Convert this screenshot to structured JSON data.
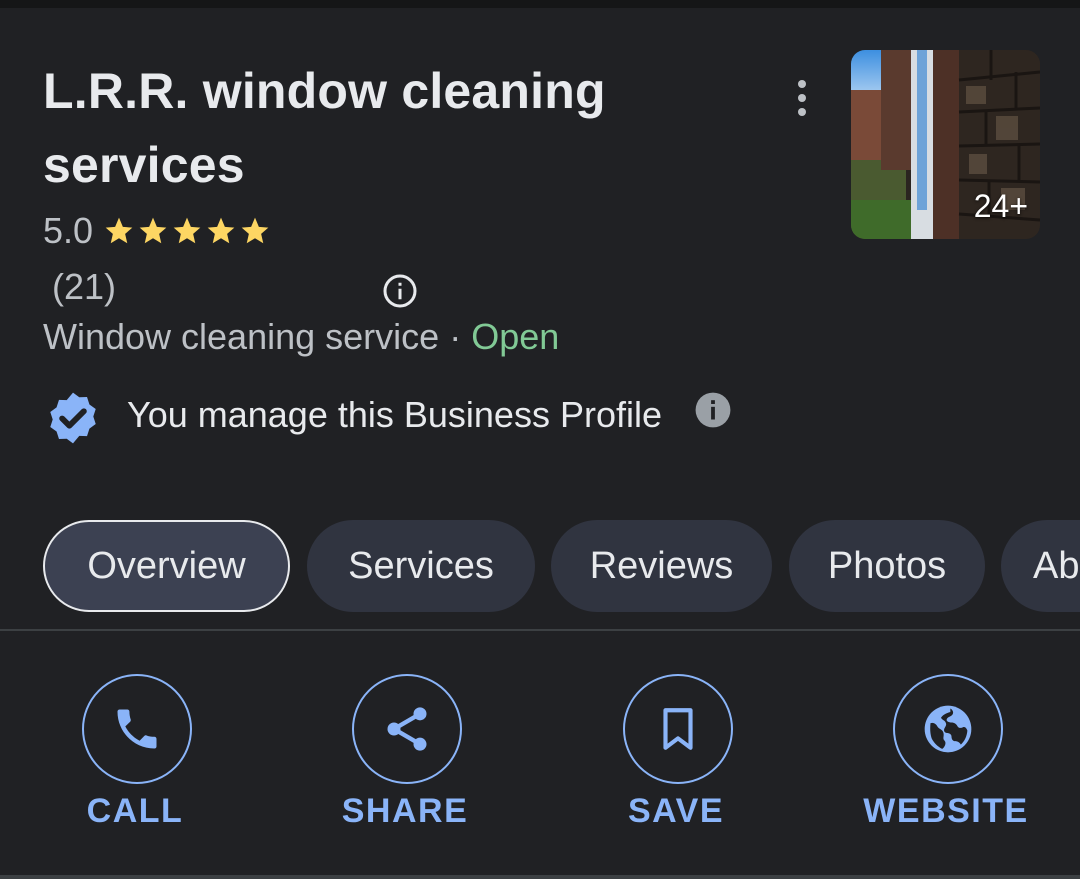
{
  "business": {
    "name": "L.R.R. window cleaning services",
    "rating": "5.0",
    "stars": 5,
    "review_count": "(21)",
    "category": "Window cleaning service",
    "separator": " · ",
    "status": "Open",
    "photo_count": "24+"
  },
  "owner_notice": {
    "text": "You manage this Business Profile"
  },
  "tabs": [
    {
      "label": "Overview",
      "active": true
    },
    {
      "label": "Services",
      "active": false
    },
    {
      "label": "Reviews",
      "active": false
    },
    {
      "label": "Photos",
      "active": false
    },
    {
      "label": "Ab",
      "active": false
    }
  ],
  "actions": {
    "call": "CALL",
    "share": "SHARE",
    "save": "SAVE",
    "website": "WEBSITE"
  },
  "colors": {
    "background": "#202124",
    "accent": "#8ab4f8",
    "open": "#81c995",
    "star": "#fdd663"
  },
  "icons": [
    "more-vert-icon",
    "star-icon",
    "info-outline-icon",
    "verified-icon",
    "info-icon",
    "phone-icon",
    "share-icon",
    "bookmark-icon",
    "globe-icon"
  ]
}
